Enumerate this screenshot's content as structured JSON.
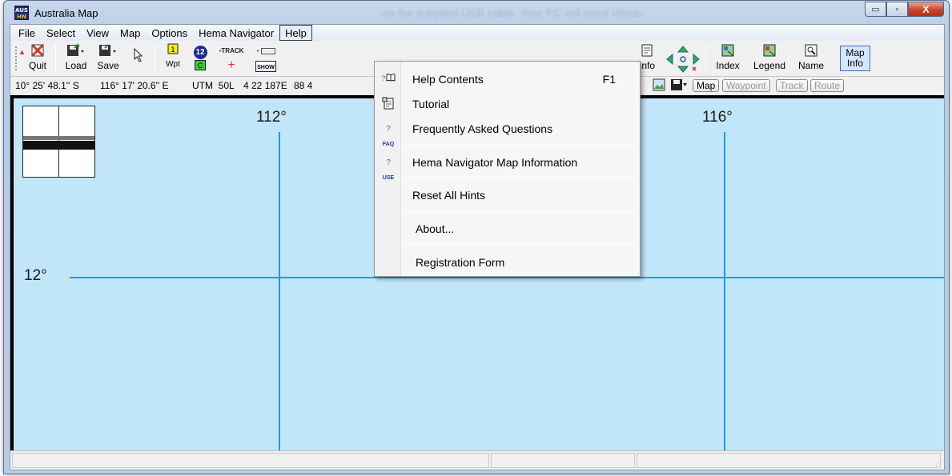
{
  "window": {
    "title": "Australia Map",
    "background_text": "via the supplied USB cable. Your PC will need Windo",
    "icon_text_top": "AUS",
    "icon_text_bottom": "HN",
    "minimize_glyph": "▭",
    "maximize_glyph": "▫",
    "close_glyph": "X"
  },
  "menubar": {
    "items": [
      "File",
      "Select",
      "View",
      "Map",
      "Options",
      "Hema Navigator",
      "Help"
    ],
    "active": "Help"
  },
  "toolbar": {
    "quit": "Quit",
    "load": "Load",
    "save": "Save",
    "wpt": "Wpt",
    "track": "TRACK",
    "show": "SHOW",
    "waypoint_number": "12",
    "waypoint_letter": "C",
    "info": "Info",
    "index": "Index",
    "legend": "Legend",
    "name": "Name",
    "map_info": "Map\nInfo"
  },
  "coords": {
    "lat": "10° 25' 48.1'' S",
    "lon": "116° 17' 20.6'' E",
    "utm": "UTM  50L",
    "easting": "4 22 187E",
    "northing": "88 4",
    "buttons": [
      "Map",
      "Waypoint",
      "Track",
      "Route"
    ]
  },
  "map": {
    "lon_labels": [
      "112°",
      "116°"
    ],
    "lat_labels": [
      "12°"
    ],
    "colors": {
      "sea": "#c1e6f9",
      "gridline": "#1a9fdc"
    }
  },
  "help_menu": {
    "items": [
      {
        "label": "Help Contents",
        "shortcut": "F1",
        "icon": "help-book-icon",
        "glyph": "?📖"
      },
      {
        "label": "Tutorial",
        "shortcut": "",
        "icon": "tutorial-icon",
        "glyph": "🗒"
      },
      {
        "label": "Frequently Asked Questions",
        "shortcut": "",
        "icon": "faq-icon",
        "glyph": "?FAQ"
      },
      {
        "label": "Hema Navigator Map Information",
        "shortcut": "",
        "icon": "use-icon",
        "glyph": "?USE"
      },
      {
        "label": "Reset All Hints",
        "shortcut": "",
        "icon": "",
        "glyph": ""
      },
      {
        "label": "About...",
        "shortcut": "",
        "icon": "",
        "glyph": ""
      },
      {
        "label": "Registration Form",
        "shortcut": "",
        "icon": "",
        "glyph": ""
      }
    ]
  }
}
